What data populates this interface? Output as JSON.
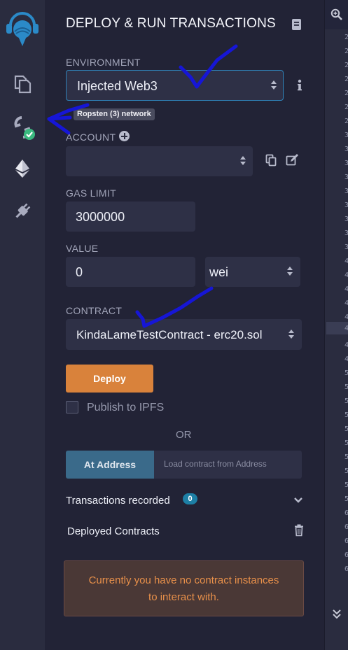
{
  "panel": {
    "title": "DEPLOY & RUN TRANSACTIONS",
    "environment_label": "ENVIRONMENT",
    "environment_value": "Injected Web3",
    "network_badge": "Ropsten (3) network",
    "account_label": "ACCOUNT",
    "account_value": "",
    "gas_limit_label": "GAS LIMIT",
    "gas_limit_value": "3000000",
    "value_label": "VALUE",
    "value_value": "0",
    "value_unit": "wei",
    "contract_label": "CONTRACT",
    "contract_value": "KindaLameTestContract - erc20.sol",
    "deploy_label": "Deploy",
    "publish_label": "Publish to IPFS",
    "or_label": "OR",
    "at_address_label": "At Address",
    "at_address_placeholder": "Load contract from Address",
    "transactions_label": "Transactions recorded",
    "transactions_count": "0",
    "deployed_label": "Deployed Contracts",
    "no_instances_line1": "Currently you have no contract instances",
    "no_instances_line2": "to interact with."
  },
  "colors": {
    "accent": "#d9823b",
    "annotation": "#1616d6",
    "badge": "#1d7fa5",
    "success": "#3ab97f",
    "warning_bg": "#4a3836",
    "warning_text": "#e8904a"
  },
  "icons": [
    "remix-logo-icon",
    "file-explorer-icon",
    "deploy-run-icon",
    "ethereum-icon",
    "plugin-icon",
    "zoom-in-icon",
    "double-chevron-down-icon"
  ]
}
